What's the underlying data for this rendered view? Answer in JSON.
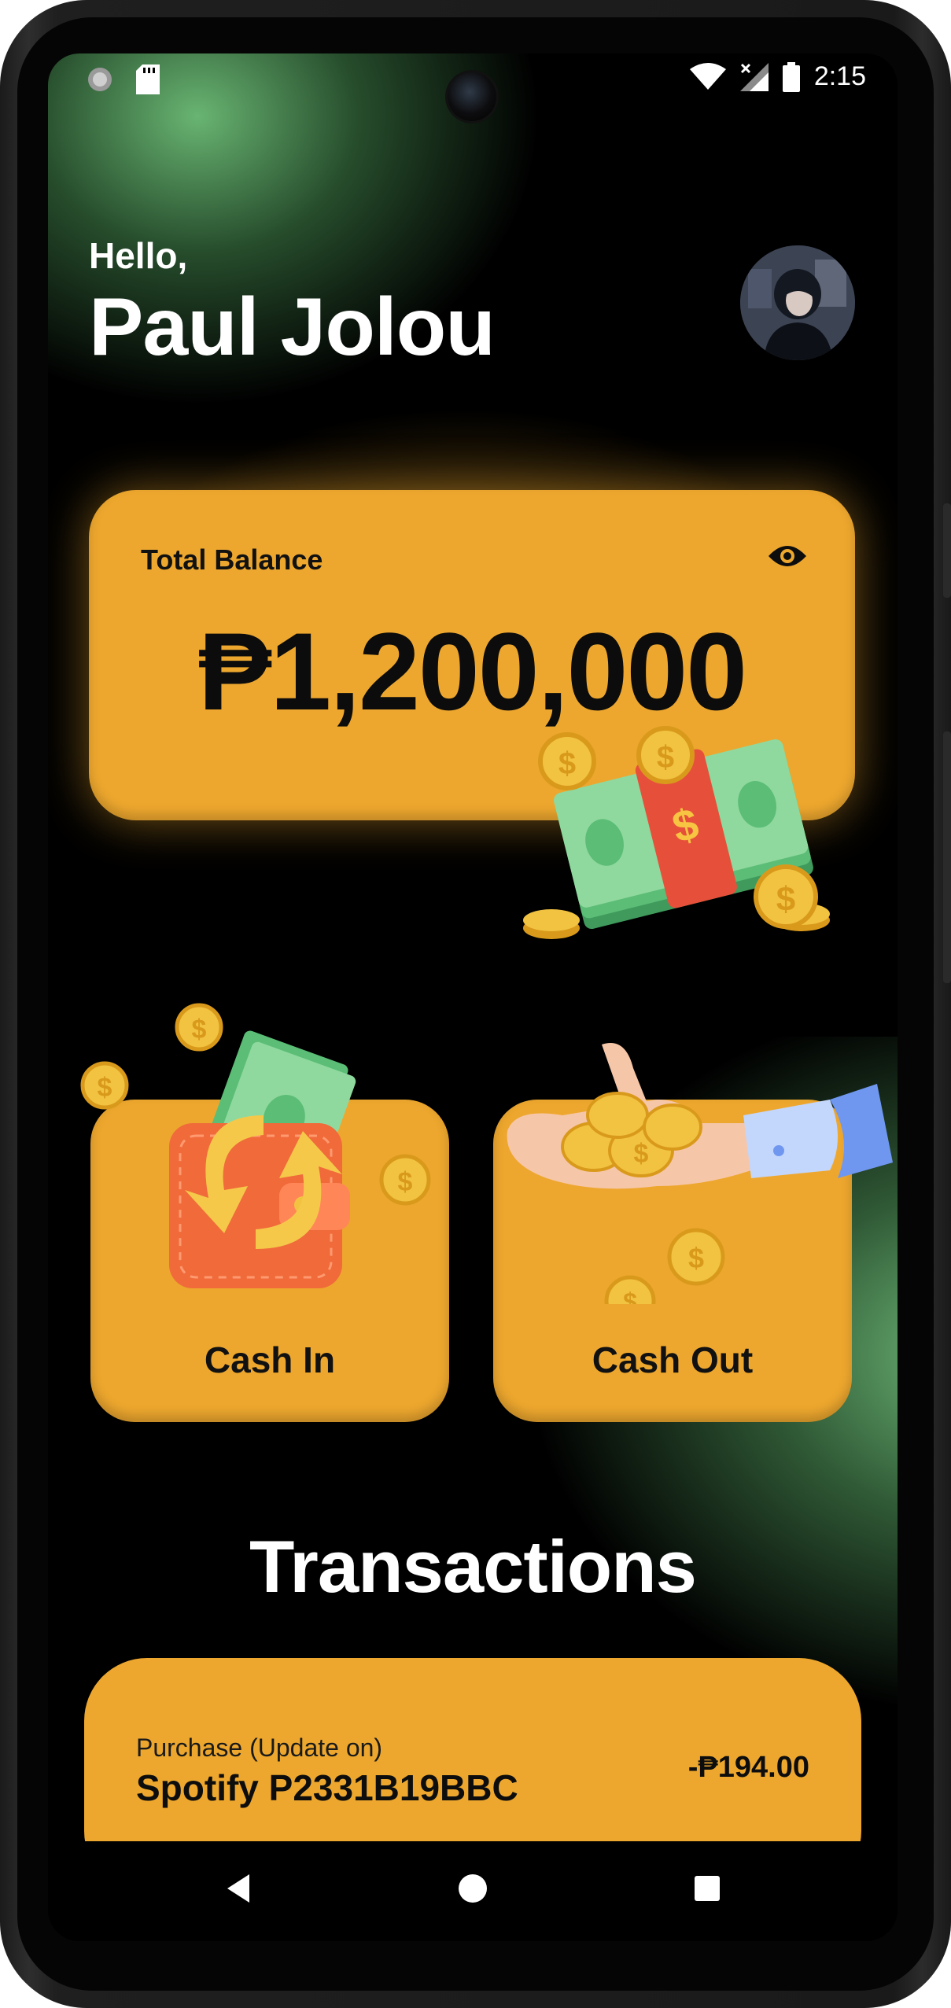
{
  "status_bar": {
    "time": "2:15",
    "left_icons": [
      "loading-icon",
      "sd-card-icon"
    ],
    "right_icons": [
      "wifi-icon",
      "signal-icon",
      "battery-icon"
    ]
  },
  "header": {
    "greeting": "Hello,",
    "user_name": "Paul Jolou"
  },
  "balance": {
    "label": "Total Balance",
    "amount": "₱1,200,000",
    "toggle_icon": "eye-icon"
  },
  "actions": {
    "cash_in": "Cash In",
    "cash_out": "Cash Out"
  },
  "transactions": {
    "heading": "Transactions",
    "items": [
      {
        "type": "Purchase (Update on)",
        "title": "Spotify P2331B19BBC",
        "amount": "-₱194.00"
      }
    ]
  },
  "navigation": {
    "buttons": [
      "back-icon",
      "home-icon",
      "recents-icon"
    ]
  },
  "colors": {
    "accent": "#eda72e",
    "background": "#000000",
    "glow": "#6fbf7a"
  }
}
